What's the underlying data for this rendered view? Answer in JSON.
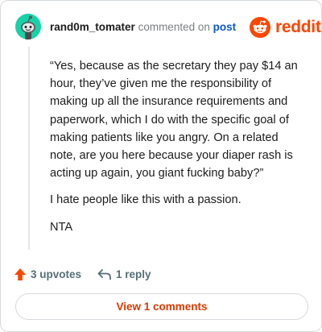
{
  "comment": {
    "username": "rand0m_tomater",
    "action_text": "commented on",
    "post_link": "post",
    "paragraphs": [
      "“Yes, because as the secretary they pay $14 an hour, they’ve given me the responsibility of making up all the insurance requirements and paperwork, which I do with the specific goal of making patients like you angry. On a related note, are you here because your diaper rash is acting up again, you giant fucking baby?”",
      "I hate people like this with a passion.",
      "NTA"
    ]
  },
  "brand": {
    "wordmark": "reddit",
    "color": "#ff4500"
  },
  "actions": {
    "upvotes_label": "3 upvotes",
    "reply_label": "1 reply"
  },
  "view_button": {
    "label": "View 1 comments"
  },
  "icons": {
    "avatar": "snoo-avatar-icon",
    "brand": "reddit-logo-icon",
    "upvote": "upvote-arrow-icon",
    "reply": "reply-arrow-icon"
  },
  "colors": {
    "avatar_bg": "#17d2a9",
    "link": "#0a58ca",
    "upvote": "#ff4500",
    "view_button_text": "#d93a00"
  }
}
